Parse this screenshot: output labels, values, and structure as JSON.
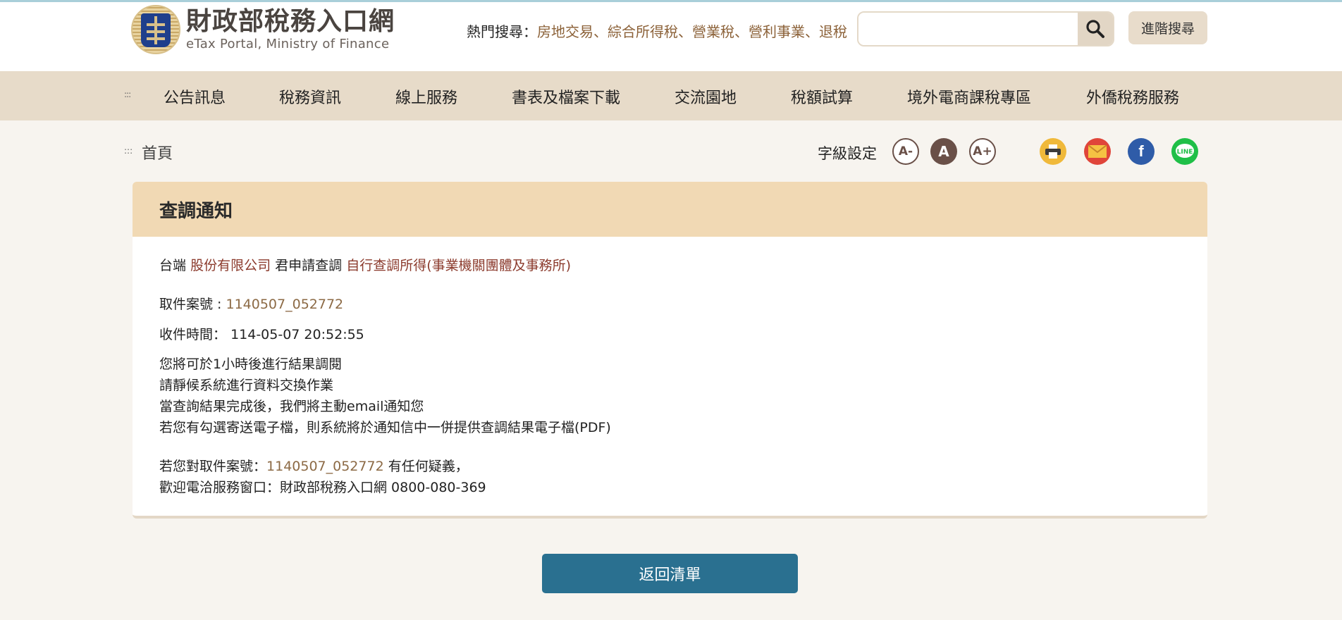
{
  "header": {
    "logo_cn": "財政部稅務入口網",
    "logo_en": "eTax Portal, Ministry of Finance",
    "hot_label": "熱門搜尋：",
    "hot_links": [
      "房地交易",
      "綜合所得稅",
      "營業稅",
      "營利事業",
      "退稅"
    ],
    "hot_sep": "、",
    "search_placeholder": "",
    "advanced_search": "進階搜尋"
  },
  "nav": {
    "items": [
      "公告訊息",
      "稅務資訊",
      "線上服務",
      "書表及檔案下載",
      "交流園地",
      "稅額試算",
      "境外電商課稅專區",
      "外僑稅務服務"
    ]
  },
  "breadcrumb": {
    "home": "首頁"
  },
  "toolbar": {
    "font_size_label": "字級設定",
    "font_small": "A-",
    "font_mid": "A",
    "font_large": "A+",
    "line_label": "LINE",
    "fb_label": "f"
  },
  "card": {
    "title": "查調通知",
    "applicant_prefix": "台端",
    "company": "股份有限公司",
    "applicant_mid": "君申請查調",
    "query_type": "自行查調所得(事業機關團體及事務所)",
    "case_label": "取件案號 : ",
    "case_no": "1140507_052772",
    "time_label": "收件時間：",
    "time_value": "114-05-07 20:52:55",
    "messages": [
      "您將可於1小時後進行結果調閱",
      "請靜候系統進行資料交換作業",
      "當查詢結果完成後，我們將主動email通知您",
      "若您有勾選寄送電子檔，則系統將於通知信中一併提供查調結果電子檔(PDF)"
    ],
    "question_prefix": "若您對取件案號：",
    "question_case_no": "1140507_052772",
    "question_suffix": " 有任何疑義，",
    "contact": "歡迎電洽服務窗口：財政部稅務入口網 0800-080-369"
  },
  "actions": {
    "back": "返回清單"
  },
  "colors": {
    "nav_bg": "#e7dbc9",
    "card_header": "#f1d9b4",
    "button": "#2a7090",
    "link": "#8c6239"
  }
}
